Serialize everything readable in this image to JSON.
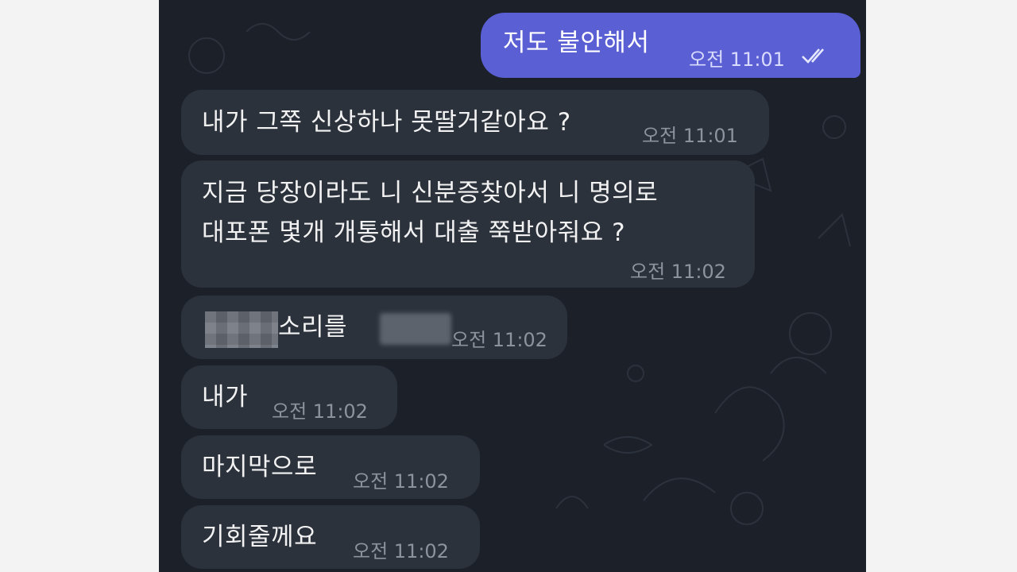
{
  "messages": [
    {
      "direction": "outgoing",
      "text": "저도 불안해서",
      "time": "오전 11:01",
      "status": "read-double-check-icon"
    },
    {
      "direction": "incoming",
      "text": "내가 그쪽 신상하나 못딸거같아요 ?",
      "time": "오전 11:01"
    },
    {
      "direction": "incoming",
      "lines": [
        "지금 당장이라도 니 신분증찾아서 니 명의로",
        "대포폰 몇개 개통해서 대출 쭉받아줘요 ?"
      ],
      "time": "오전 11:02"
    },
    {
      "direction": "incoming",
      "text_visible": "소리를",
      "time": "오전 11:02",
      "redacted": true
    },
    {
      "direction": "incoming",
      "text": "내가",
      "time": "오전 11:02"
    },
    {
      "direction": "incoming",
      "text": "마지막으로",
      "time": "오전 11:02"
    },
    {
      "direction": "incoming",
      "text": "기회줄께요",
      "time": "오전 11:02"
    }
  ],
  "colors": {
    "chat_background": "#1b2029",
    "incoming_bubble": "#2c323c",
    "outgoing_bubble": "#5b5fd4",
    "page_background": "#f3f3f3"
  }
}
